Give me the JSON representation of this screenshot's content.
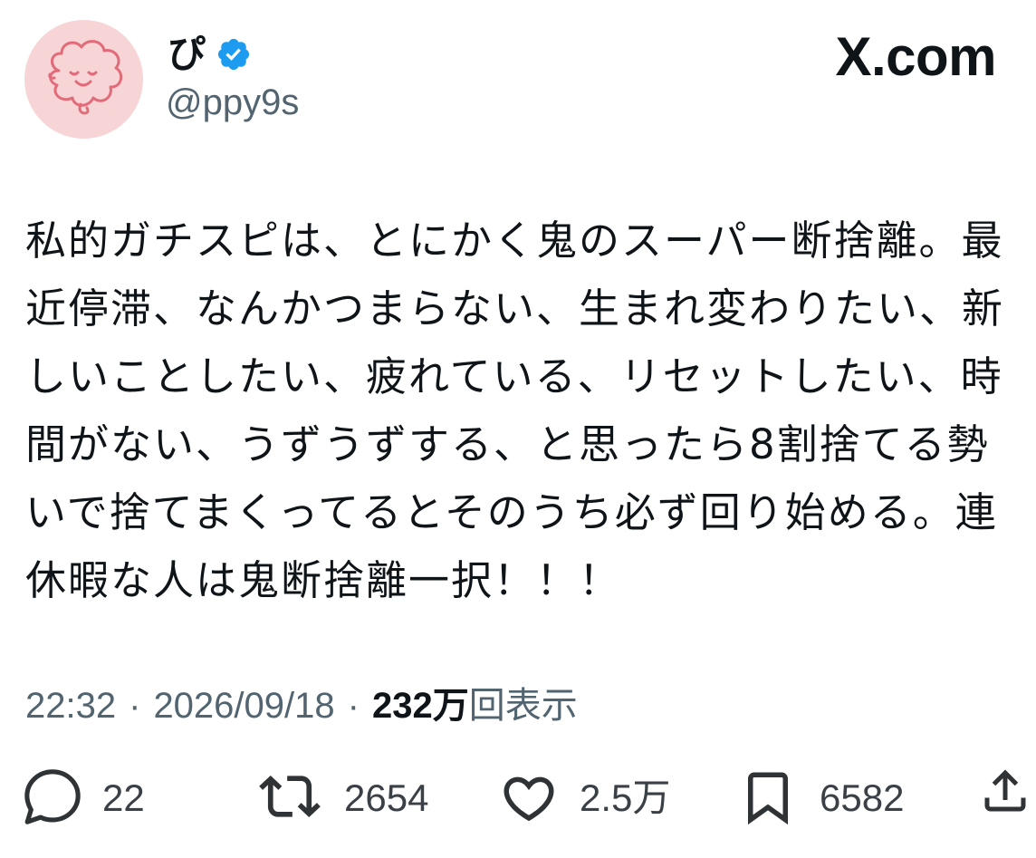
{
  "brand": {
    "logo_text": "X.com"
  },
  "author": {
    "display_name": "ぴ",
    "handle": "@ppy9s",
    "verified": true,
    "verified_icon": "verified-badge-icon"
  },
  "tweet": {
    "text_lines": [
      "私的ガチスピは、とにかく鬼のスーパー断捨離。最",
      "近停滞、なんかつまらない、生まれ変わりたい、新",
      "しいことしたい、疲れている、リセットしたい、時",
      "間がない、うずうずする、と思ったら8割捨てる勢",
      "いで捨てまくってるとそのうち必ず回り始める。連",
      "休暇な人は鬼断捨離一択！！！"
    ],
    "time": "22:32",
    "separator": "·",
    "date": "2026/09/18",
    "views_count": "232万",
    "views_label": "回表示"
  },
  "actions": {
    "reply": {
      "icon": "reply-icon",
      "count": "22"
    },
    "retweet": {
      "icon": "retweet-icon",
      "count": "2654"
    },
    "like": {
      "icon": "heart-icon",
      "count": "2.5万"
    },
    "bookmark": {
      "icon": "bookmark-icon",
      "count": "6582"
    },
    "share": {
      "icon": "share-icon"
    }
  },
  "colors": {
    "text_primary": "#0f1419",
    "text_secondary": "#536471",
    "verified_blue": "#1d9bf0",
    "avatar_background": "#f7d4d6",
    "avatar_drawing": "#e26b7a",
    "icon": "#2f3336"
  }
}
